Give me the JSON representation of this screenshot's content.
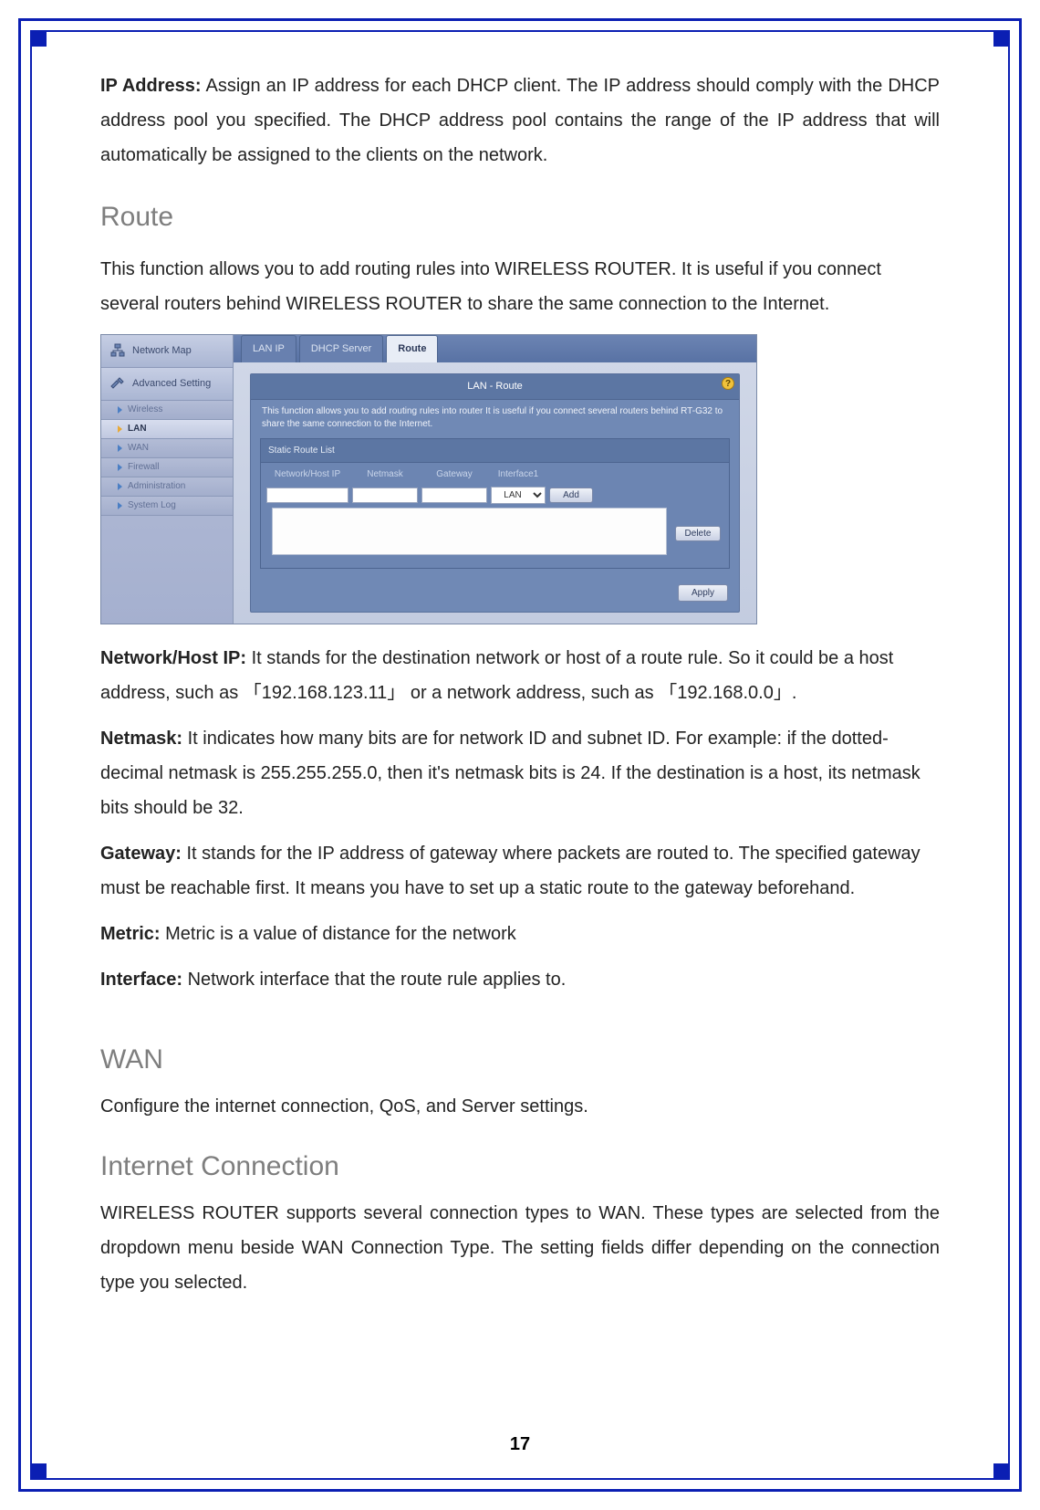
{
  "doc": {
    "ip_address_label": "IP Address:",
    "ip_address_text": " Assign an IP address for each DHCP client. The IP address should comply with the DHCP address pool you specified. The DHCP address pool contains the range of the IP address that will automatically be assigned to the clients on the network.",
    "route_heading": "Route",
    "route_intro": "This function allows you to add routing rules into WIRELESS ROUTER. It is useful if you connect several routers behind WIRELESS ROUTER to share the same connection to the Internet.",
    "nethost_label": "Network/Host IP:",
    "nethost_text": " It stands for the destination network or host of a route rule. So it could be a host address, such as 「192.168.123.11」 or a network address, such as 「192.168.0.0」.",
    "netmask_label": "Netmask:",
    "netmask_text": " It indicates how many bits are for network ID and subnet ID. For example: if the dotted-decimal netmask is 255.255.255.0, then it's netmask bits is 24. If the destination is a host, its netmask bits should be 32.",
    "gateway_label": "Gateway:",
    "gateway_text": " It stands for the IP address of gateway where packets are routed to. The specified gateway must be reachable first. It means you have to set up a static route to the gateway beforehand.",
    "metric_label": "Metric:",
    "metric_text": " Metric is a value of distance for the network",
    "interface_label": "Interface:",
    "interface_text": " Network interface that the route rule applies to.",
    "wan_heading": "WAN",
    "wan_text": "Configure the internet connection, QoS, and Server settings.",
    "ic_heading": "Internet Connection",
    "ic_text": "WIRELESS ROUTER supports several connection types to WAN. These types are selected from the dropdown menu beside WAN Connection Type. The setting fields differ depending on the connection type you selected.",
    "page_number": "17"
  },
  "ui": {
    "sidebar": {
      "main1": "Network Map",
      "main2": "Advanced Setting",
      "items": [
        {
          "label": "Wireless",
          "active": false
        },
        {
          "label": "LAN",
          "active": true
        },
        {
          "label": "WAN",
          "active": false
        },
        {
          "label": "Firewall",
          "active": false
        },
        {
          "label": "Administration",
          "active": false
        },
        {
          "label": "System Log",
          "active": false
        }
      ]
    },
    "tabs": {
      "t1": "LAN IP",
      "t2": "DHCP Server",
      "t3": "Route"
    },
    "panel": {
      "title": "LAN - Route",
      "help": "?",
      "desc": "This function allows you to add routing rules into router    It is useful if you connect several routers behind RT-G32 to share the same connection to the Internet.",
      "box_title": "Static Route List",
      "cols": {
        "c1": "Network/Host IP",
        "c2": "Netmask",
        "c3": "Gateway",
        "c4": "Interface1"
      },
      "iface_value": "LAN",
      "btn_add": "Add",
      "btn_delete": "Delete",
      "btn_apply": "Apply"
    }
  }
}
